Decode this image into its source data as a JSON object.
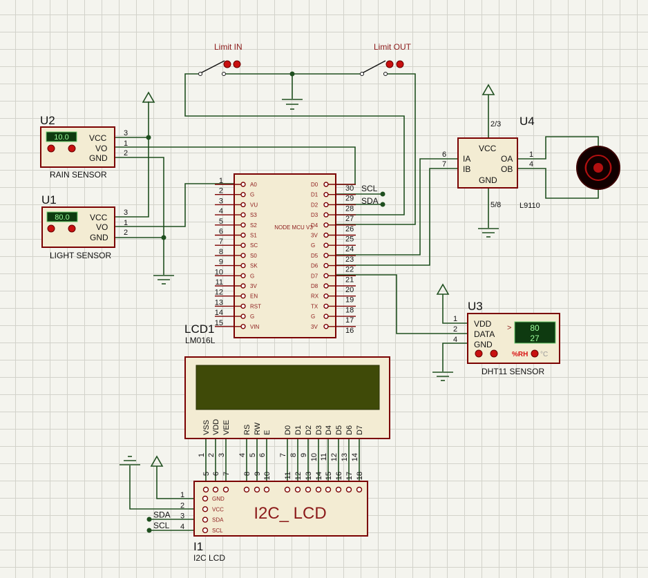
{
  "switches": {
    "limit_in": "Limit IN",
    "limit_out": "Limit OUT"
  },
  "u2": {
    "ref": "U2",
    "name": "RAIN SENSOR",
    "display": "10.0",
    "pins": [
      "VCC",
      "VO",
      "GND"
    ],
    "pin_numbers": [
      "3",
      "1",
      "2"
    ]
  },
  "u1": {
    "ref": "U1",
    "name": "LIGHT SENSOR",
    "display": "80.0",
    "pins": [
      "VCC",
      "VO",
      "GND"
    ],
    "pin_numbers": [
      "3",
      "1",
      "2"
    ]
  },
  "mcu": {
    "label": "NODE MCU V3",
    "left_pins": [
      {
        "num": "1",
        "name": "A0"
      },
      {
        "num": "2",
        "name": "G"
      },
      {
        "num": "3",
        "name": "VU"
      },
      {
        "num": "4",
        "name": "S3"
      },
      {
        "num": "5",
        "name": "S2"
      },
      {
        "num": "6",
        "name": "S1"
      },
      {
        "num": "7",
        "name": "SC"
      },
      {
        "num": "8",
        "name": "S0"
      },
      {
        "num": "9",
        "name": "SK"
      },
      {
        "num": "10",
        "name": "G"
      },
      {
        "num": "11",
        "name": "3V"
      },
      {
        "num": "12",
        "name": "EN"
      },
      {
        "num": "13",
        "name": "RST"
      },
      {
        "num": "14",
        "name": "G"
      },
      {
        "num": "15",
        "name": "VIN"
      }
    ],
    "right_pins": [
      {
        "num": "30",
        "name": "D0"
      },
      {
        "num": "29",
        "name": "D1"
      },
      {
        "num": "28",
        "name": "D2"
      },
      {
        "num": "27",
        "name": "D3"
      },
      {
        "num": "26",
        "name": "D4"
      },
      {
        "num": "25",
        "name": "3V"
      },
      {
        "num": "24",
        "name": "G"
      },
      {
        "num": "23",
        "name": "D5"
      },
      {
        "num": "22",
        "name": "D6"
      },
      {
        "num": "21",
        "name": "D7"
      },
      {
        "num": "20",
        "name": "D8"
      },
      {
        "num": "19",
        "name": "RX"
      },
      {
        "num": "18",
        "name": "TX"
      },
      {
        "num": "17",
        "name": "G"
      },
      {
        "num": "16",
        "name": "3V"
      }
    ],
    "scl": "SCL",
    "sda": "SDA"
  },
  "u4": {
    "ref": "U4",
    "name": "L9110",
    "pins": {
      "vcc": "VCC",
      "ia": "IA",
      "ib": "IB",
      "gnd": "GND",
      "oa": "OA",
      "ob": "OB"
    },
    "pin_numbers": {
      "vcc": "2/3",
      "ia": "6",
      "ib": "7",
      "gnd": "5/8",
      "oa": "1",
      "ob": "4"
    }
  },
  "u3": {
    "ref": "U3",
    "name": "DHT11 SENSOR",
    "humidity": "80",
    "temperature": "27",
    "pins": [
      "VDD",
      "DATA",
      "GND"
    ],
    "pin_numbers": [
      "1",
      "2",
      "4"
    ],
    "rh_label": "%RH",
    "c_label": "°C",
    "arrow": ">"
  },
  "lcd1": {
    "ref": "LCD1",
    "model": "LM016L",
    "pins": [
      {
        "name": "VSS",
        "num": "1"
      },
      {
        "name": "VDD",
        "num": "2"
      },
      {
        "name": "VEE",
        "num": "3"
      },
      {
        "name": "RS",
        "num": "4"
      },
      {
        "name": "RW",
        "num": "5"
      },
      {
        "name": "E",
        "num": "6"
      },
      {
        "name": "D0",
        "num": "7"
      },
      {
        "name": "D1",
        "num": "8"
      },
      {
        "name": "D2",
        "num": "9"
      },
      {
        "name": "D3",
        "num": "10"
      },
      {
        "name": "D4",
        "num": "11"
      },
      {
        "name": "D5",
        "num": "12"
      },
      {
        "name": "D6",
        "num": "13"
      },
      {
        "name": "D7",
        "num": "14"
      }
    ]
  },
  "i1": {
    "ref": "I1",
    "name": "I2C LCD",
    "title": "I2C_ LCD",
    "left_pins": [
      {
        "num": "1",
        "name": "GND",
        "net": ""
      },
      {
        "num": "2",
        "name": "VCC",
        "net": ""
      },
      {
        "num": "3",
        "name": "SDA",
        "net": "SDA"
      },
      {
        "num": "4",
        "name": "SCL",
        "net": "SCL"
      }
    ],
    "top_pins": [
      "5",
      "6",
      "7",
      "8",
      "9",
      "10",
      "11",
      "12",
      "13",
      "14",
      "15",
      "16",
      "17",
      "18"
    ]
  }
}
